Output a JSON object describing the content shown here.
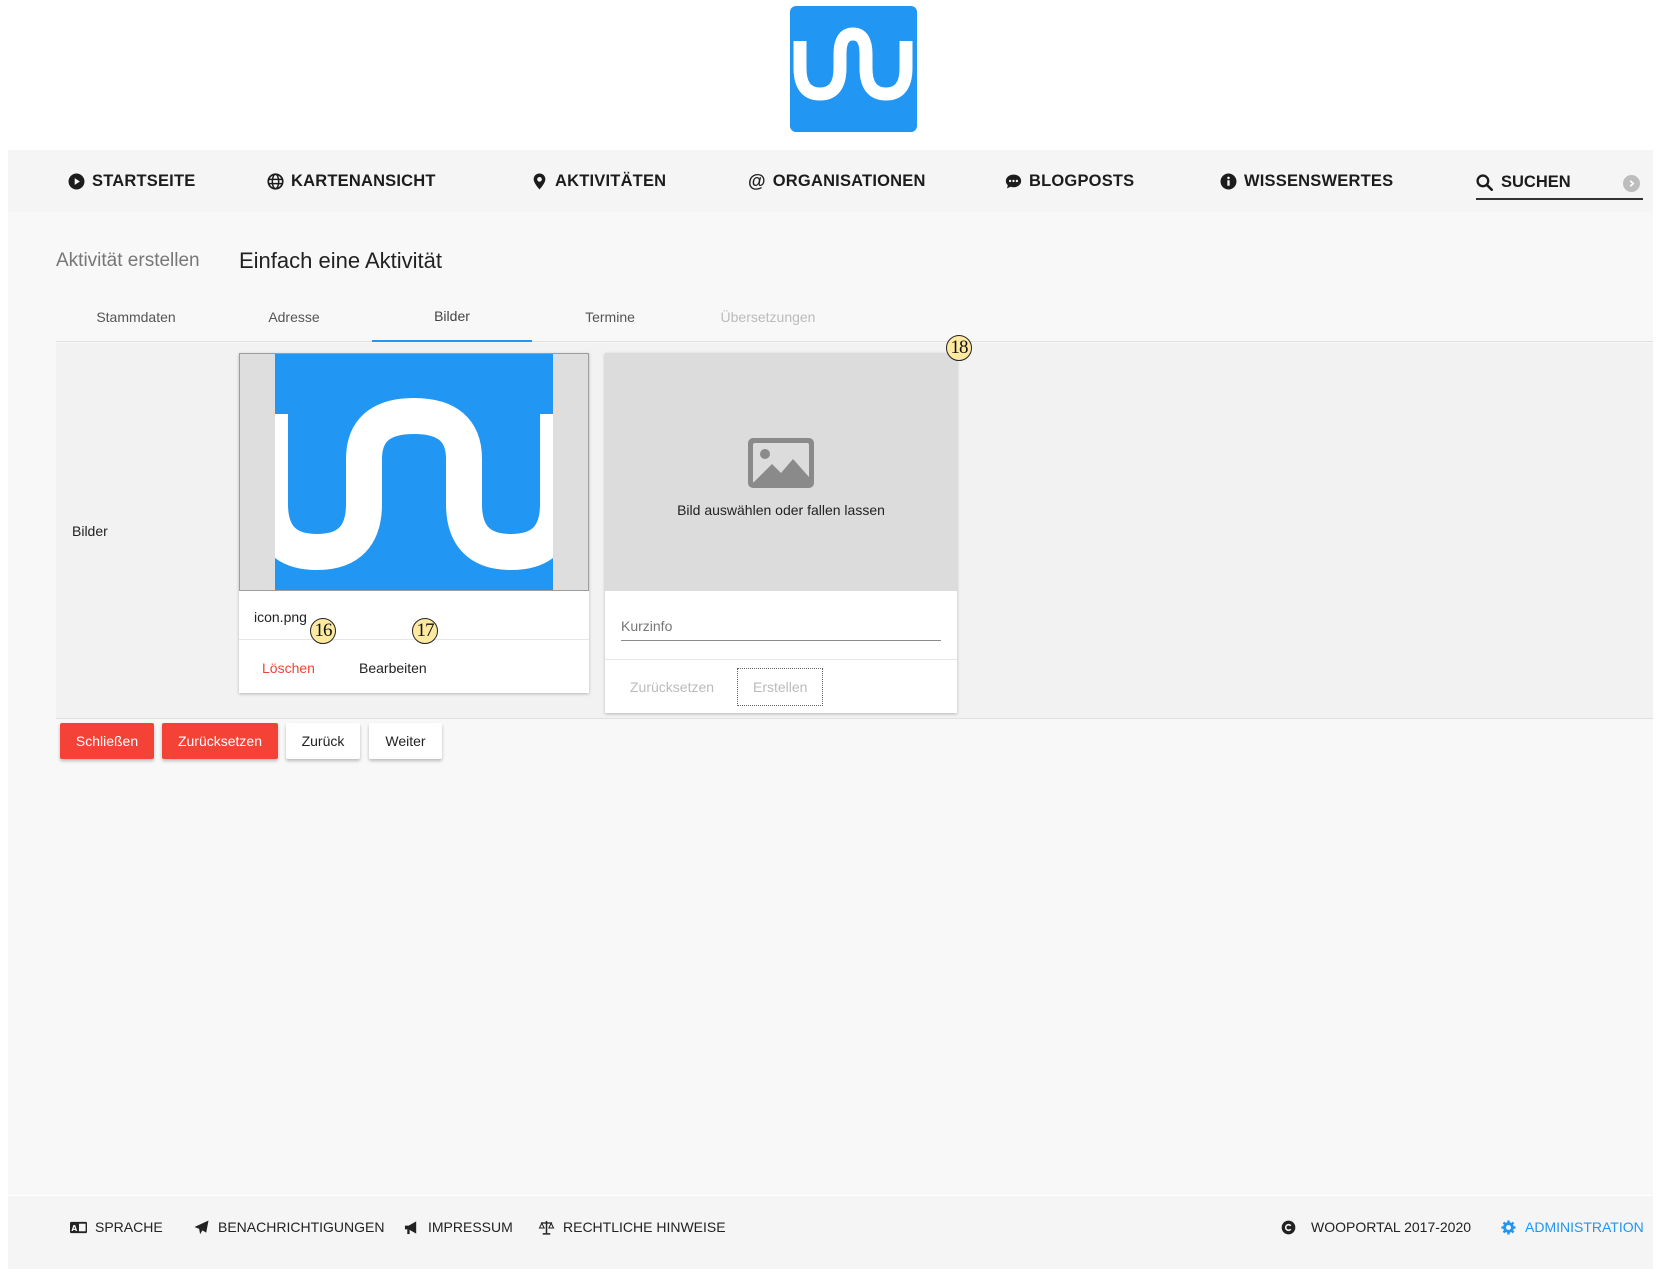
{
  "logo": {
    "icon": "wooportal-wave-logo",
    "color": "#2196f3"
  },
  "nav": {
    "items": [
      {
        "label": "STARTSEITE",
        "icon": "play-circle-icon"
      },
      {
        "label": "KARTENANSICHT",
        "icon": "globe-icon"
      },
      {
        "label": "AKTIVITÄTEN",
        "icon": "map-marker-icon"
      },
      {
        "label": "ORGANISATIONEN",
        "icon": "at-icon"
      },
      {
        "label": "BLOGPOSTS",
        "icon": "comment-dots-icon"
      },
      {
        "label": "WISSENSWERTES",
        "icon": "info-circle-icon"
      }
    ],
    "search": {
      "placeholder": "SUCHEN",
      "icon": "search-icon"
    }
  },
  "page": {
    "breadcrumb": "Aktivität erstellen",
    "title": "Einfach eine Aktivität"
  },
  "tabs": [
    {
      "label": "Stammdaten",
      "state": "normal"
    },
    {
      "label": "Adresse",
      "state": "normal"
    },
    {
      "label": "Bilder",
      "state": "active"
    },
    {
      "label": "Termine",
      "state": "normal"
    },
    {
      "label": "Übersetzungen",
      "state": "disabled"
    }
  ],
  "form": {
    "row_label": "Bilder",
    "image_card": {
      "file_name": "icon.png",
      "delete_label": "Löschen",
      "edit_label": "Bearbeiten"
    },
    "upload_card": {
      "drop_text": "Bild auswählen oder fallen lassen",
      "caption_placeholder": "Kurzinfo",
      "caption_value": "",
      "reset_label": "Zurücksetzen",
      "create_label": "Erstellen"
    },
    "badges": [
      "16",
      "17",
      "18"
    ]
  },
  "actions": {
    "close_label": "Schließen",
    "reset_label": "Zurücksetzen",
    "back_label": "Zurück",
    "next_label": "Weiter"
  },
  "footer": {
    "language": "SPRACHE",
    "notifications": "BENACHRICHTIGUNGEN",
    "imprint": "IMPRESSUM",
    "legal": "RECHTLICHE HINWEISE",
    "copyright": "WOOPORTAL 2017-2020",
    "admin": "ADMINISTRATION"
  },
  "colors": {
    "accent": "#2196f3",
    "danger": "#f44336",
    "badge": "#fdeaa0"
  }
}
